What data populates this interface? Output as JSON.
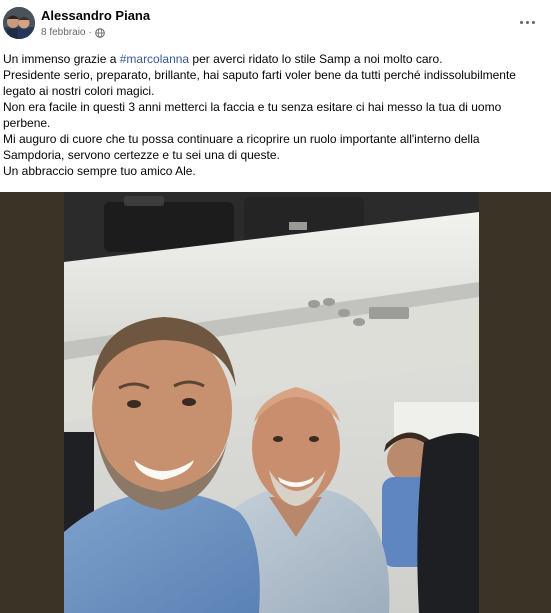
{
  "post": {
    "author": "Alessandro Piana",
    "date": "8 febbraio",
    "separator": "·",
    "audience_icon": "globe-icon",
    "more_icon": "more-options-icon",
    "text": {
      "line1_before": "Un immenso grazie a ",
      "hashtag": "#marcolanna",
      "line1_after": " per averci ridato  lo stile Samp a noi molto caro.",
      "line2": "Presidente serio, preparato, brillante,  hai saputo farti voler bene da tutti perché indissolubilmente",
      "line3": "legato ai nostri colori magici.",
      "line4": "Non era facile in questi 3 anni metterci la faccia e tu senza esitare ci hai messo la tua di uomo",
      "line5": "perbene.",
      "line6": "Mi auguro di cuore che tu possa continuare a ricoprire un ruolo importante all'interno della",
      "line7": "Sampdoria, servono certezze e tu sei una di queste.",
      "line8": "Un abbraccio sempre tuo amico Ale."
    }
  },
  "colors": {
    "text": "#050505",
    "secondary_text": "#65676b",
    "link": "#385898",
    "photo_backdrop": "#3a3426"
  }
}
